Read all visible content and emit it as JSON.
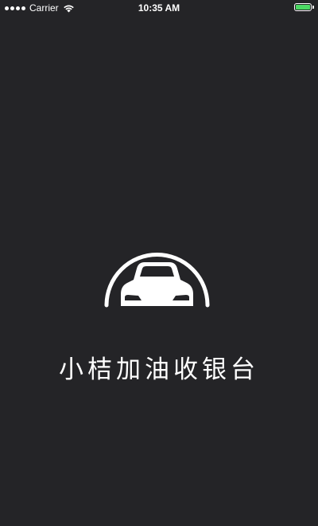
{
  "status_bar": {
    "carrier": "Carrier",
    "time": "10:35 AM",
    "signal_icon": "signal-dots-icon",
    "wifi_icon": "wifi-icon",
    "battery_icon": "battery-icon",
    "battery_color": "#4cd964",
    "battery_level": 1.0
  },
  "splash": {
    "logo_icon": "car-logo-icon",
    "title": "小桔加油收银台"
  },
  "colors": {
    "background": "#242427",
    "foreground": "#ffffff"
  }
}
